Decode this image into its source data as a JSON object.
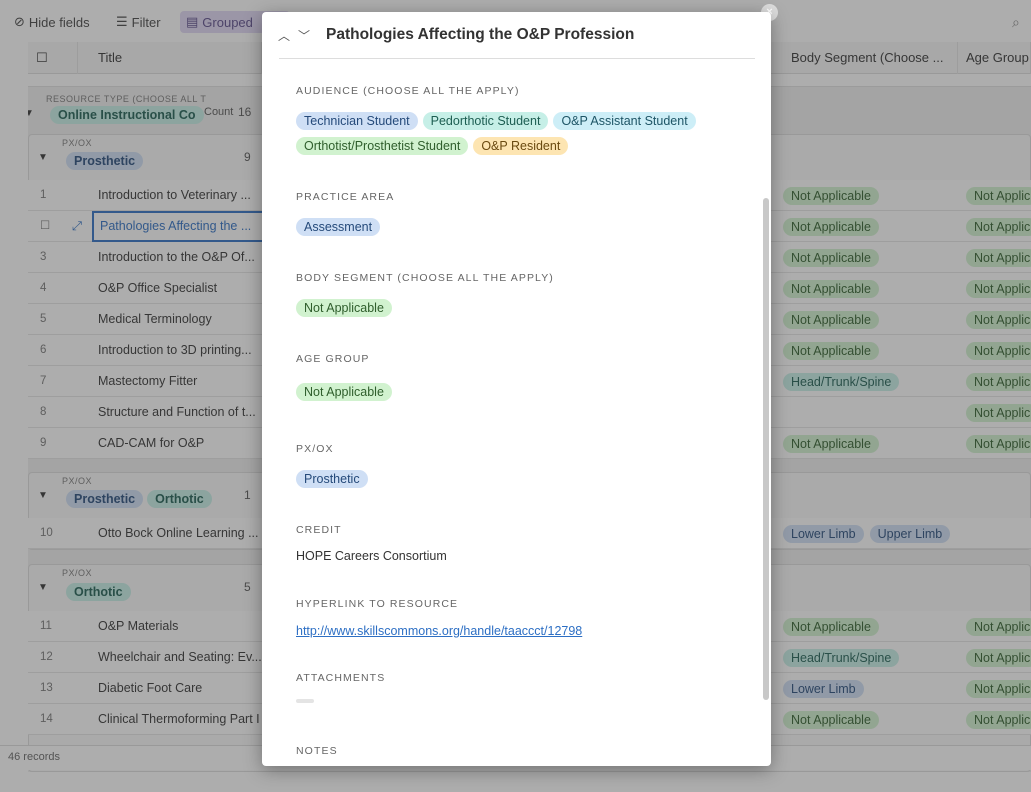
{
  "toolbar": {
    "hide_fields": "Hide fields",
    "filter": "Filter",
    "grouped": "Grouped"
  },
  "grid": {
    "columns": {
      "title": "Title",
      "body_segment": "Body Segment (Choose ...",
      "age_group": "Age Group"
    },
    "group1": {
      "header": "RESOURCE TYPE (CHOOSE ALL T",
      "value": "Online Instructional Co",
      "count_label": "Count",
      "count": "16"
    },
    "subgroups": [
      {
        "header": "PX/OX",
        "pills": [
          "Prosthetic"
        ],
        "count": "9"
      },
      {
        "header": "PX/OX",
        "pills": [
          "Prosthetic",
          "Orthotic"
        ],
        "count": "1"
      },
      {
        "header": "PX/OX",
        "pills": [
          "Orthotic"
        ],
        "count": "5"
      }
    ],
    "rows": [
      {
        "num": "1",
        "title": "Introduction to Veterinary ...",
        "body": [
          "Not Applicable"
        ],
        "age": "Not Applic"
      },
      {
        "num": "",
        "title": "Pathologies Affecting the ...",
        "body": [
          "Not Applicable"
        ],
        "age": "Not Applic"
      },
      {
        "num": "3",
        "title": "Introduction to the O&P Of...",
        "body": [
          "Not Applicable"
        ],
        "age": "Not Applic"
      },
      {
        "num": "4",
        "title": "O&P Office Specialist",
        "body": [
          "Not Applicable"
        ],
        "age": "Not Applic"
      },
      {
        "num": "5",
        "title": "Medical Terminology",
        "body": [
          "Not Applicable"
        ],
        "age": "Not Applic"
      },
      {
        "num": "6",
        "title": "Introduction to 3D printing...",
        "body": [
          "Not Applicable"
        ],
        "age": "Not Applic"
      },
      {
        "num": "7",
        "title": "Mastectomy Fitter",
        "body": [
          "Head/Trunk/Spine"
        ],
        "age": "Not Applic"
      },
      {
        "num": "8",
        "title": "Structure and Function of t...",
        "body": [],
        "age": "Not Applic"
      },
      {
        "num": "9",
        "title": "CAD-CAM for O&P",
        "body": [
          "Not Applicable"
        ],
        "age": "Not Applic"
      },
      {
        "num": "10",
        "title": "Otto Bock Online Learning ...",
        "body": [
          "Lower Limb",
          "Upper Limb"
        ],
        "age": ""
      },
      {
        "num": "11",
        "title": "O&P Materials",
        "body": [
          "Not Applicable"
        ],
        "age": "Not Applic"
      },
      {
        "num": "12",
        "title": "Wheelchair and Seating: Ev...",
        "body": [
          "Head/Trunk/Spine"
        ],
        "age": "Not Applic"
      },
      {
        "num": "13",
        "title": "Diabetic Foot Care",
        "body": [
          "Lower Limb"
        ],
        "age": "Not Applic"
      },
      {
        "num": "14",
        "title": "Clinical Thermoforming Part I",
        "body": [
          "Not Applicable"
        ],
        "age": "Not Applic"
      }
    ],
    "footer": "46 records"
  },
  "modal": {
    "title": "Pathologies Affecting the O&P Profession",
    "audience": {
      "label": "AUDIENCE (CHOOSE ALL THE APPLY)",
      "pills": [
        {
          "text": "Technician Student",
          "color": "blue"
        },
        {
          "text": "Pedorthotic Student",
          "color": "teal"
        },
        {
          "text": "O&P Assistant Student",
          "color": "cyan"
        },
        {
          "text": "Orthotist/Prosthetist Student",
          "color": "green"
        },
        {
          "text": "O&P Resident",
          "color": "yellow"
        }
      ]
    },
    "practice_area": {
      "label": "PRACTICE AREA",
      "value": "Assessment"
    },
    "body_segment": {
      "label": "BODY SEGMENT (CHOOSE ALL THE APPLY)",
      "value": "Not Applicable"
    },
    "age_group": {
      "label": "AGE GROUP",
      "value": "Not Applicable"
    },
    "pxox": {
      "label": "PX/OX",
      "value": "Prosthetic"
    },
    "credit": {
      "label": "CREDIT",
      "value": "HOPE Careers Consortium"
    },
    "hyperlink": {
      "label": "HYPERLINK TO RESOURCE",
      "value": "http://www.skillscommons.org/handle/taaccct/12798"
    },
    "attachments": {
      "label": "ATTACHMENTS"
    },
    "notes": {
      "label": "NOTES"
    }
  },
  "colors": {
    "overlay": "#3c3c3c",
    "link": "#2d6fc4",
    "pill_green": "#d1f2cf",
    "pill_blue": "#cfdff5",
    "pill_teal": "#c6efe7",
    "pill_yellow": "#fde5b2",
    "pill_purple": "#dcd3f0"
  }
}
